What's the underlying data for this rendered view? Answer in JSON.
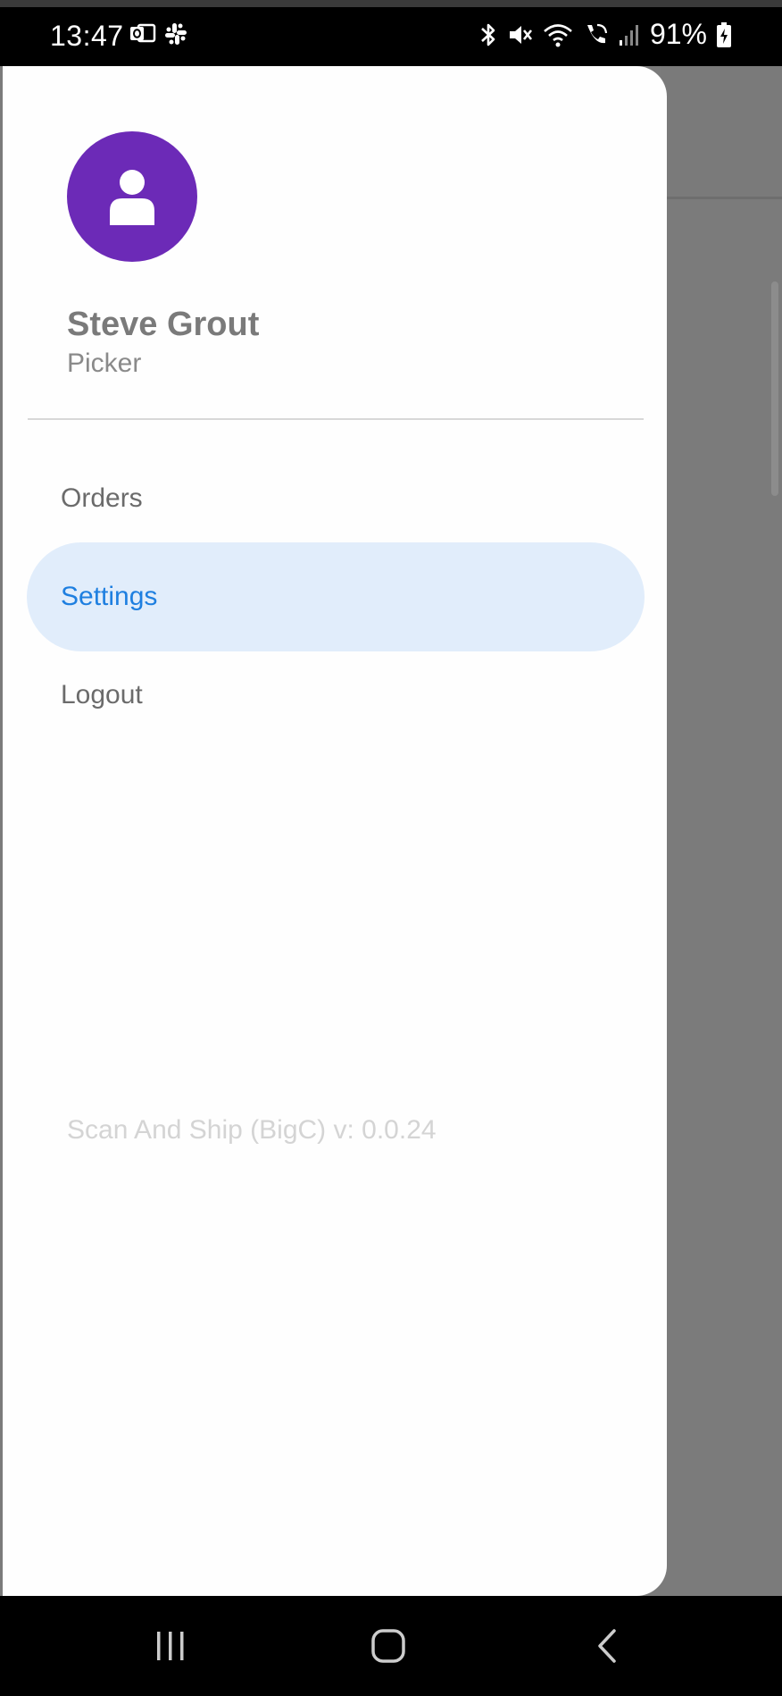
{
  "status_bar": {
    "time": "13:47",
    "battery_pct": "91%",
    "left_icons": [
      "outlook-icon",
      "slack-icon"
    ],
    "right_icons": [
      "bluetooth-icon",
      "mute-icon",
      "wifi-icon",
      "wifi-call-icon",
      "signal-icon",
      "battery-charging-icon"
    ]
  },
  "drawer": {
    "user": {
      "name": "Steve Grout",
      "role": "Picker",
      "avatar_icon": "person-icon",
      "avatar_color": "#6c2ab7"
    },
    "menu": [
      {
        "label": "Orders",
        "active": false
      },
      {
        "label": "Settings",
        "active": true
      },
      {
        "label": "Logout",
        "active": false
      }
    ],
    "version": "Scan And Ship (BigC) v: 0.0.24",
    "accent_color": "#1e7fe0",
    "active_bg_color": "#e1edfb"
  },
  "nav_bar": {
    "icons": [
      "recent-apps-icon",
      "home-icon",
      "back-icon"
    ]
  }
}
